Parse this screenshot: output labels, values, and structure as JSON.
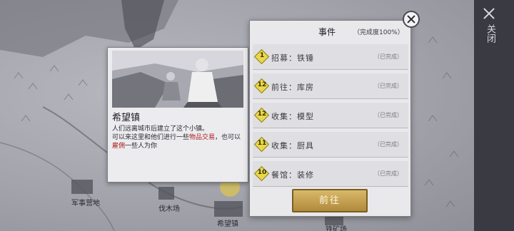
{
  "map": {
    "labels": [
      {
        "text": "军事营地",
        "name": "military-camp"
      },
      {
        "text": "伐木场",
        "name": "lumber-yard"
      },
      {
        "text": "希望镇",
        "name": "hope-town"
      },
      {
        "text": "铁矿场",
        "name": "iron-mine"
      }
    ]
  },
  "close_panel": {
    "label": "关闭"
  },
  "town": {
    "name": "希望镇",
    "desc_part1": "人们远离城市后建立了这个小镇。",
    "desc_part2": "可以来这里和他们进行一些",
    "desc_hl1": "物品交易",
    "desc_part3": "，也可以",
    "desc_hl2": "雇佣",
    "desc_part4": "一些人为你"
  },
  "event_panel": {
    "title": "事件",
    "progress": "（完成度100%）",
    "tasks": [
      {
        "num": "1",
        "text": "招募：铁锤",
        "status": "（已完成）"
      },
      {
        "num": "12",
        "text": "前往：库房",
        "status": "（已完成）"
      },
      {
        "num": "12",
        "text": "收集：模型",
        "status": "（已完成）"
      },
      {
        "num": "11",
        "text": "收集：厨具",
        "status": "（已完成）"
      },
      {
        "num": "10",
        "text": "餐馆：装修",
        "status": "（已完成）"
      }
    ],
    "go_button": "前往"
  },
  "colors": {
    "badge": "#e8d84a",
    "highlight": "#b01c1c",
    "button": "#c9a452"
  }
}
